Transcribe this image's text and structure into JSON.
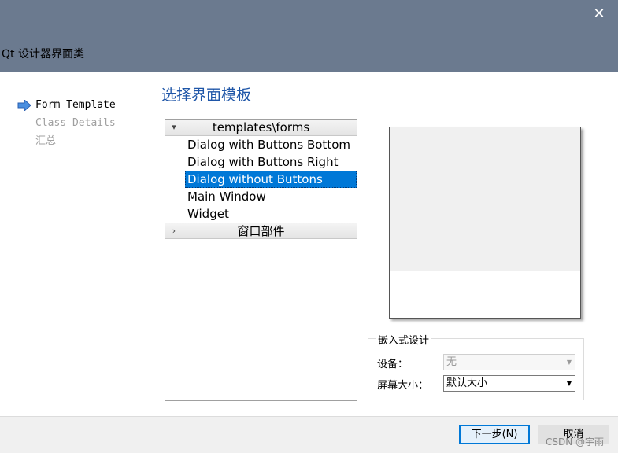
{
  "window": {
    "title": "Qt 设计器界面类",
    "close_glyph": "✕"
  },
  "steps": [
    {
      "label": "Form Template",
      "current": true
    },
    {
      "label": "Class Details",
      "current": false
    },
    {
      "label": "汇总",
      "current": false
    }
  ],
  "heading": "选择界面模板",
  "tree": {
    "groups": [
      {
        "label": "templates\\forms",
        "expanded": true,
        "items": [
          {
            "label": "Dialog with Buttons Bottom",
            "selected": false
          },
          {
            "label": "Dialog with Buttons Right",
            "selected": false
          },
          {
            "label": "Dialog without Buttons",
            "selected": true
          },
          {
            "label": "Main Window",
            "selected": false
          },
          {
            "label": "Widget",
            "selected": false
          }
        ]
      },
      {
        "label": "窗口部件",
        "expanded": false,
        "items": []
      }
    ]
  },
  "embedded": {
    "legend": "嵌入式设计",
    "device_label": "设备：",
    "device_value": "无",
    "screen_label": "屏幕大小：",
    "screen_value": "默认大小"
  },
  "buttons": {
    "next": "下一步(N)",
    "cancel": "取消"
  },
  "watermark": "CSDN @宇雨_",
  "colors": {
    "titlebar": "#6b7a8f",
    "accent": "#0078d7",
    "heading": "#1f56a8"
  }
}
